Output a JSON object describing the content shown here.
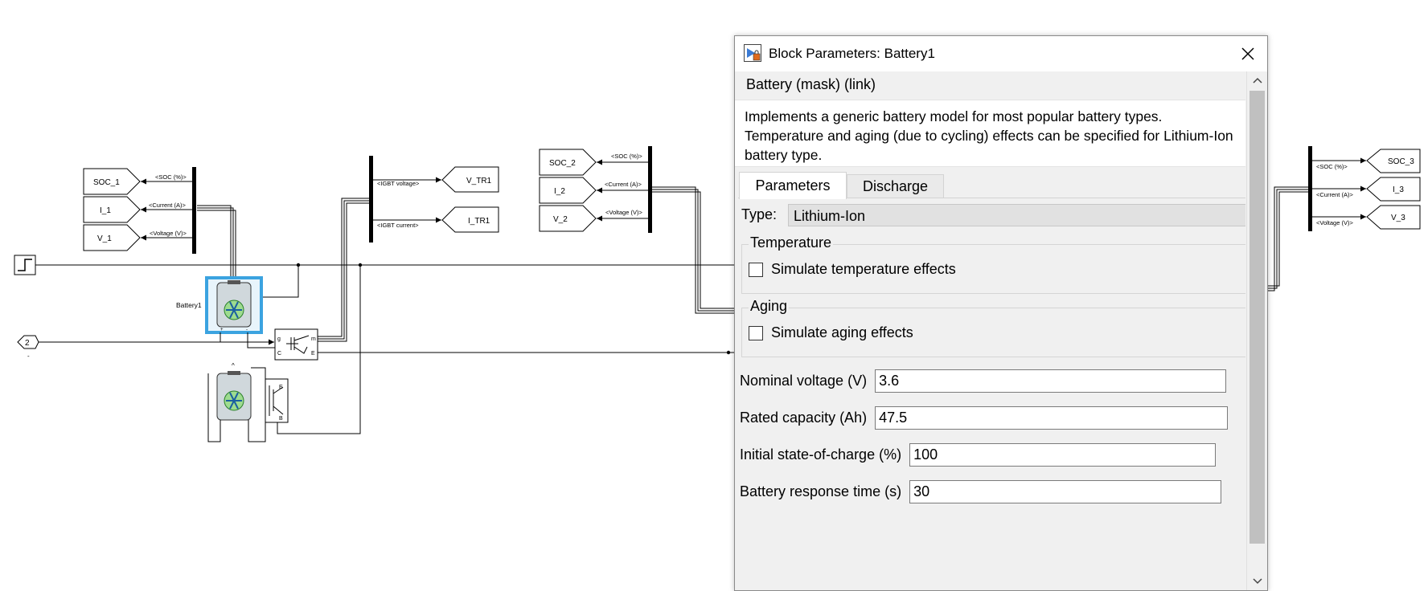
{
  "diagram": {
    "soc1_tag": "SOC_1",
    "i1_tag": "I_1",
    "v1_tag": "V_1",
    "soc_signal": "<SOC (%)>",
    "current_signal": "<Current (A)>",
    "voltage_signal": "<Voltage (V)>",
    "igbt_voltage_signal": "<IGBT voltage>",
    "igbt_current_signal": "<IGBT current>",
    "vtr1_tag": "V_TR1",
    "itr1_tag": "I_TR1",
    "soc2_tag": "SOC_2",
    "i2_tag": "I_2",
    "v2_tag": "V_2",
    "soc3_tag": "SOC_3",
    "i3_tag": "I_3",
    "v3_tag": "V_3",
    "battery1_label": "Battery1",
    "inport_number": "2",
    "port_g": "g",
    "port_m": "m",
    "port_c": "C",
    "port_e": "E",
    "selected_color": "#3ba3e0"
  },
  "dialog": {
    "title": "Block Parameters: Battery1",
    "mask_heading": "Battery (mask) (link)",
    "description": "Implements a generic battery model for most popular battery types. Temperature and aging (due to cycling) effects can be specified for Lithium-Ion battery type.",
    "tabs": [
      "Parameters",
      "Discharge"
    ],
    "active_tab": "Parameters",
    "type_label": "Type:",
    "type_value": "Lithium-Ion",
    "temperature": {
      "title": "Temperature",
      "checkbox_label": "Simulate temperature effects",
      "checked": false
    },
    "aging": {
      "title": "Aging",
      "checkbox_label": "Simulate aging effects",
      "checked": false
    },
    "fields": [
      {
        "label": "Nominal voltage (V)",
        "value": "3.6"
      },
      {
        "label": "Rated capacity (Ah)",
        "value": "47.5"
      },
      {
        "label": "Initial state-of-charge (%)",
        "value": "100"
      },
      {
        "label": "Battery response time (s)",
        "value": "30"
      }
    ]
  }
}
